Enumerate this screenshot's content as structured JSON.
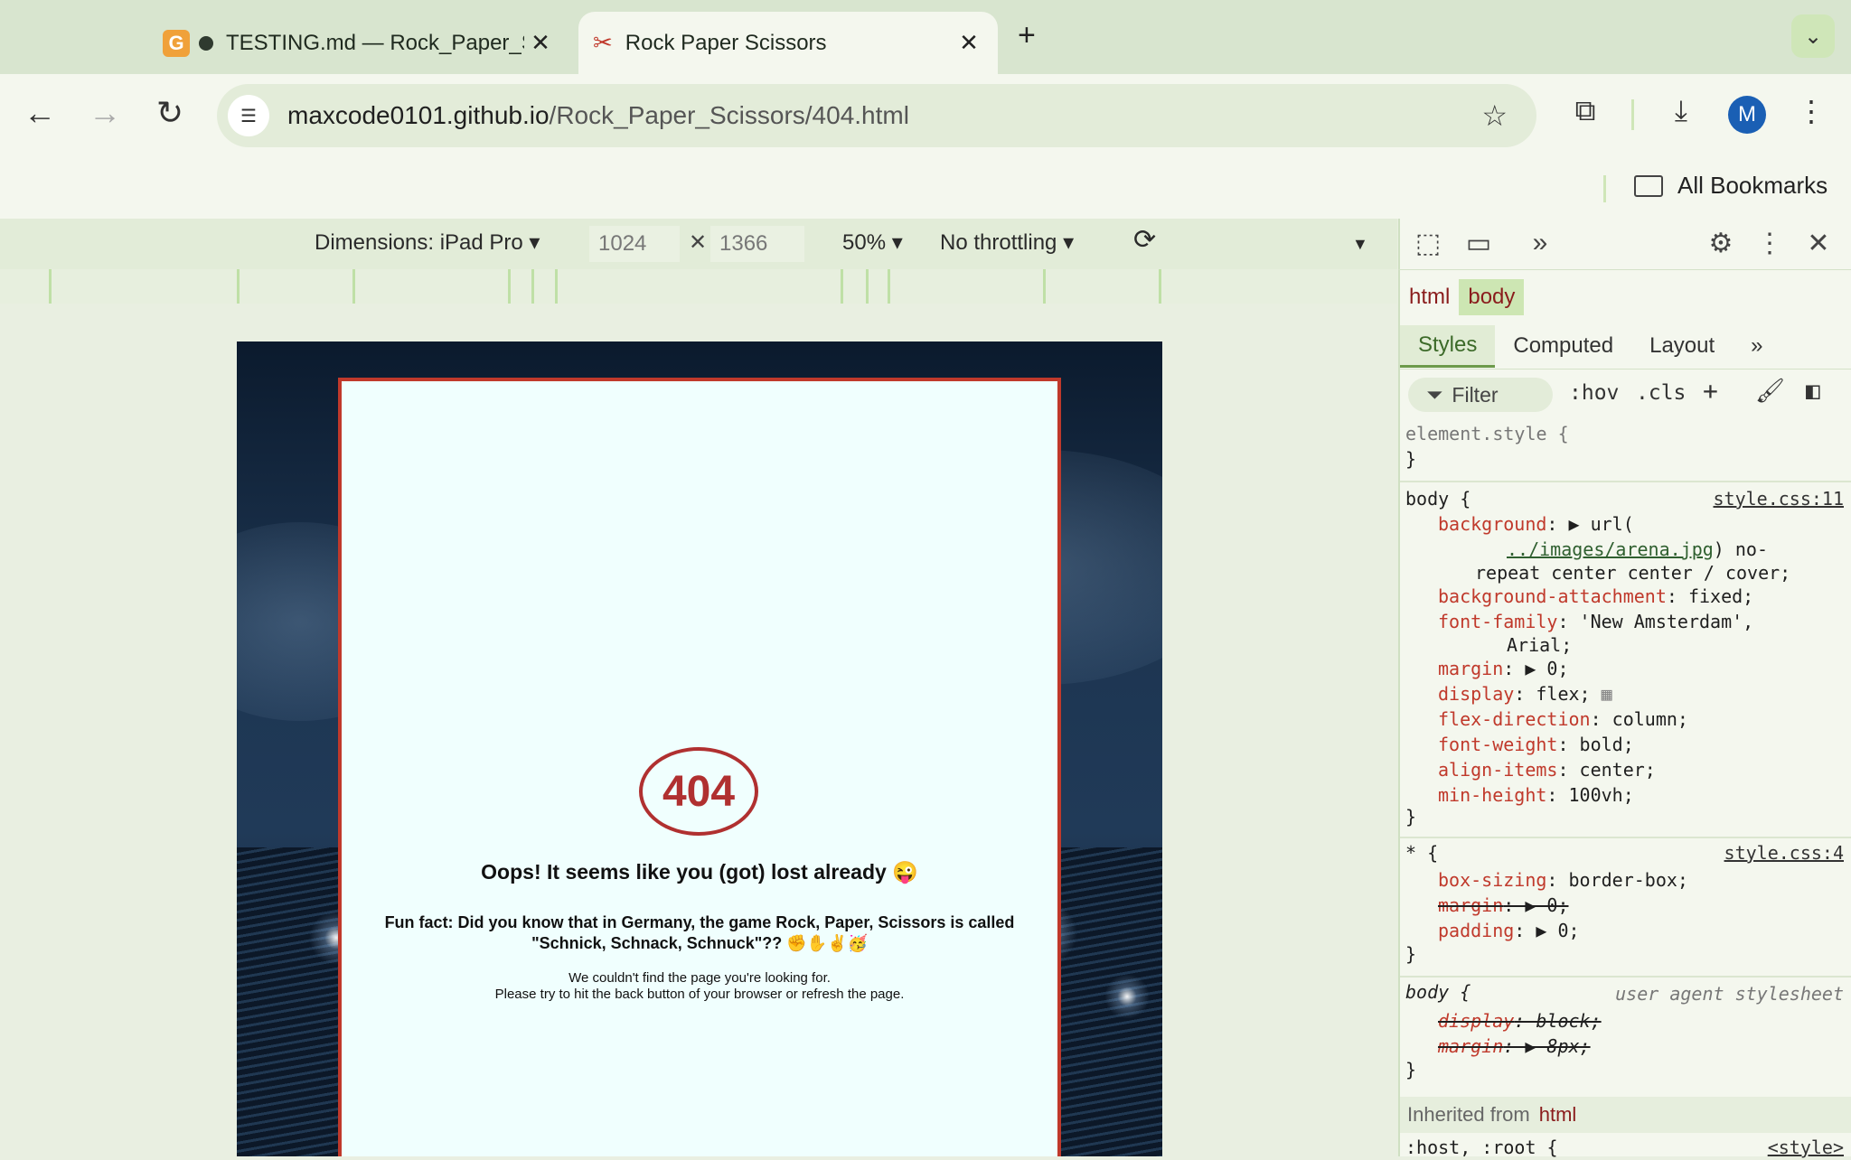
{
  "browser": {
    "tabs": [
      {
        "title": "TESTING.md — Rock_Paper_Scissors",
        "active": false
      },
      {
        "title": "Rock Paper Scissors",
        "active": true
      }
    ],
    "address": {
      "domain": "maxcode0101.github.io",
      "path": "/Rock_Paper_Scissors/404.html"
    },
    "avatar_letter": "M",
    "bookmarks_label": "All Bookmarks"
  },
  "device_toolbar": {
    "dimensions_label": "Dimensions: iPad Pro",
    "width": "1024",
    "height": "1366",
    "zoom": "50%",
    "throttling": "No throttling"
  },
  "page": {
    "badge": "404",
    "heading": "Oops! It seems like you (got) lost already 😜",
    "fun_fact_line1": "Fun fact: Did you know that in Germany, the game Rock, Paper, Scissors is called",
    "fun_fact_line2": "\"Schnick, Schnack, Schnuck\"?? ✊✋✌🥳",
    "message_line1": "We couldn't find the page you're looking for.",
    "message_line2": "Please try to hit the back button of your browser or refresh the page."
  },
  "devtools": {
    "breadcrumbs": [
      "html",
      "body"
    ],
    "tabs": [
      "Styles",
      "Computed",
      "Layout"
    ],
    "filter_placeholder": "Filter",
    "hov": ":hov",
    "cls": ".cls",
    "element_style": "element.style {",
    "close_brace": "}",
    "body_rule": {
      "selector": "body {",
      "source": "style.css:11",
      "background_prop": "background",
      "background_val_pre": ": ▶ url(",
      "background_url": "../images/arena.jpg",
      "background_val_post": ") no-",
      "background_val_cont": "repeat center center / cover;",
      "bg_attach_prop": "background-attachment",
      "bg_attach_val": ": fixed;",
      "font_family_prop": "font-family",
      "font_family_val": ": 'New Amsterdam',",
      "font_family_cont": "Arial;",
      "margin_prop": "margin",
      "margin_val": ": ▶ 0;",
      "display_prop": "display",
      "display_val": ": flex;",
      "flex_dir_prop": "flex-direction",
      "flex_dir_val": ": column;",
      "font_weight_prop": "font-weight",
      "font_weight_val": ": bold;",
      "align_items_prop": "align-items",
      "align_items_val": ": center;",
      "min_height_prop": "min-height",
      "min_height_val": ": 100vh;"
    },
    "star_rule": {
      "selector": "* {",
      "source": "style.css:4",
      "box_sizing_prop": "box-sizing",
      "box_sizing_val": ": border-box;",
      "margin_prop": "margin",
      "margin_val": ": ▶ 0;",
      "padding_prop": "padding",
      "padding_val": ": ▶ 0;"
    },
    "ua_rule": {
      "selector": "body {",
      "source": "user agent stylesheet",
      "display_prop": "display",
      "display_val": ": block;",
      "margin_prop": "margin",
      "margin_val": ": ▶ 8px;"
    },
    "inherited_label": "Inherited from",
    "inherited_tag": "html",
    "last_line": ":host, :root {",
    "last_source": "<style>"
  }
}
